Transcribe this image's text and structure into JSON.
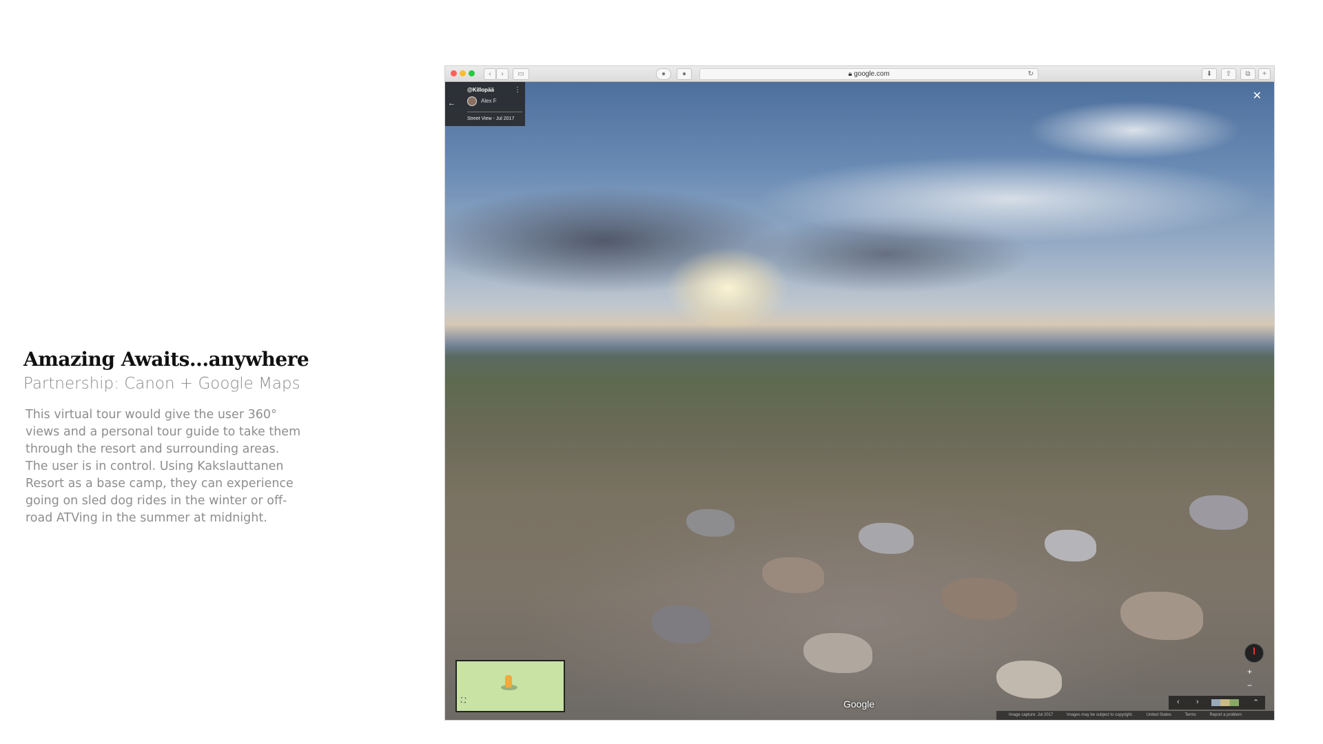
{
  "slide": {
    "title": "Amazing Awaits...anywhere",
    "subtitle": "Partnership: Canon + Google Maps",
    "body": "This virtual tour would give the user 360° views and a personal tour guide to take them through the resort and surrounding areas. The user is in control. Using Kakslauttanen Resort as a base camp, they can experience going on sled dog rides in the winter or off-road ATVing in the summer at midnight."
  },
  "browser": {
    "address": "google.com",
    "lock_icon": "lock-icon",
    "window_buttons": {
      "close": "#ff5f57",
      "minimize": "#febc2e",
      "maximize": "#28c840"
    }
  },
  "streetview": {
    "place": "@Killopää",
    "author": "Alex F",
    "date_label": "Street View - Jul 2017",
    "close_label": "✕",
    "back_label": "←",
    "menu_label": "⋮",
    "logo": "Google",
    "zoom_in": "+",
    "zoom_out": "−",
    "footer": {
      "capture": "Image capture: Jul 2017",
      "copyright": "Images may be subject to copyright.",
      "region": "United States",
      "terms": "Terms",
      "report": "Report a problem"
    }
  }
}
